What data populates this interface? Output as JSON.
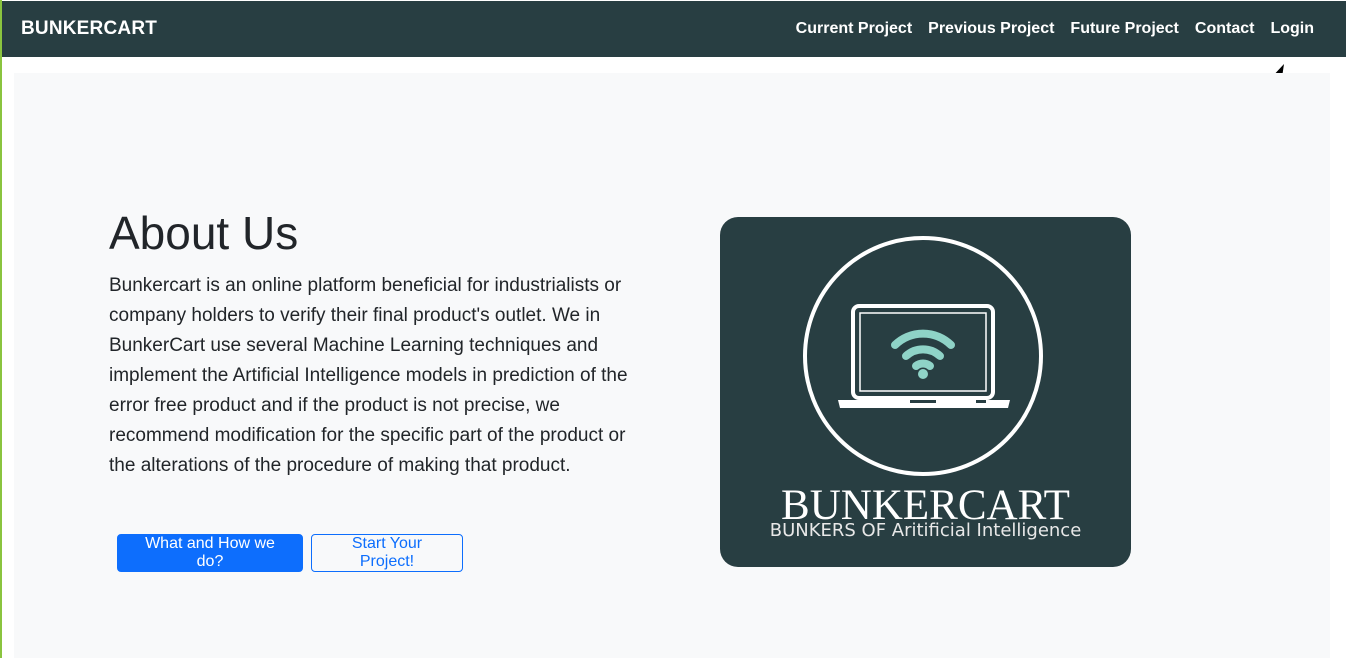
{
  "navbar": {
    "brand": "BUNKERCART",
    "links": [
      "Current Project",
      "Previous Project",
      "Future Project",
      "Contact",
      "Login"
    ]
  },
  "about": {
    "title": "About Us",
    "description": "Bunkercart is an online platform beneficial for industrialists or company holders to verify their final product's outlet. We in BunkerCart use several Machine Learning techniques and implement the Artificial Intelligence models in prediction of the error free product and if the product is not precise, we recommend modification for the specific part of the product or the alterations of the procedure of making that product.",
    "primary_button": "What and How we do?",
    "secondary_button": "Start Your Project!"
  },
  "logo": {
    "name": "BUNKERCART",
    "tagline": "BUNKERS OF Aritificial Intelligence",
    "icon": "laptop-wifi-icon"
  },
  "colors": {
    "navbar": "#283e42",
    "accent": "#0d6efd",
    "section_bg": "#f8f9fa",
    "wifi": "#8fd3c7"
  }
}
